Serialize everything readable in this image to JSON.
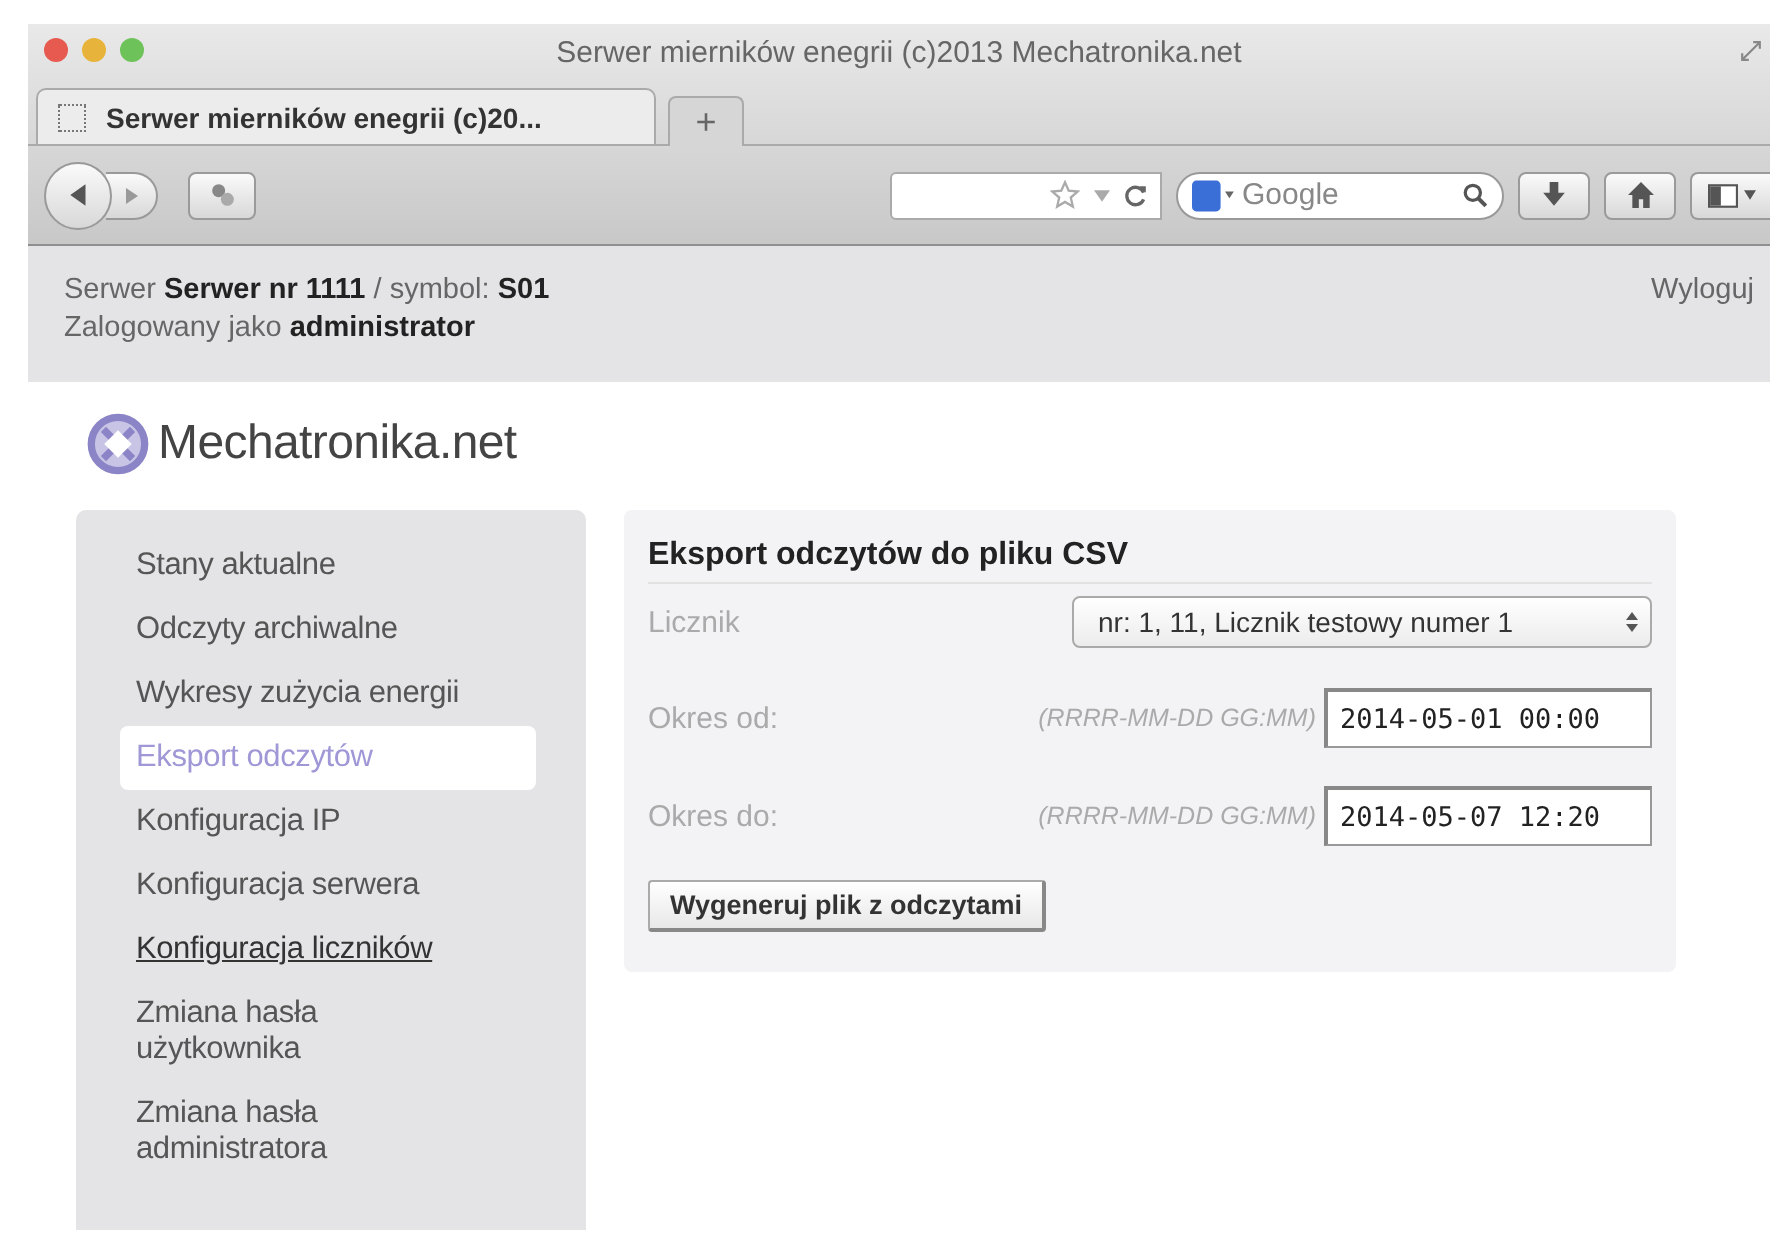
{
  "window": {
    "title": "Serwer mierników enegrii (c)2013 Mechatronika.net"
  },
  "browser": {
    "tabs": [
      {
        "label": "Serwer mierników enegrii (c)20...",
        "selected": true
      }
    ],
    "new_tab": "+",
    "search": {
      "placeholder": "Google"
    }
  },
  "header": {
    "server_line": "Serwer **Serwer nr 1111** / symbol: **S01**",
    "login_line": "Zalogowany jako **administrator**",
    "logout": "Wyloguj"
  },
  "logo": {
    "text": "Mechatronika.net"
  },
  "menu": {
    "items": [
      {
        "label": "Stany aktualne",
        "selected": false,
        "hovered": false
      },
      {
        "label": "Odczyty archiwalne",
        "selected": false,
        "hovered": false
      },
      {
        "label": "Wykresy zużycia energii",
        "selected": false,
        "hovered": false
      },
      {
        "label": "Eksport odczytów",
        "selected": true,
        "hovered": false
      },
      {
        "label": "Konfiguracja IP",
        "selected": false,
        "hovered": false
      },
      {
        "label": "Konfiguracja serwera",
        "selected": false,
        "hovered": false
      },
      {
        "label": "Konfiguracja liczników",
        "selected": false,
        "hovered": true
      },
      {
        "label": "Zmiana hasła użytkownika",
        "selected": false,
        "hovered": false
      },
      {
        "label": "Zmiana hasła administratora",
        "selected": false,
        "hovered": false
      }
    ]
  },
  "panel": {
    "title": "Eksport odczytów do pliku CSV",
    "fields": [
      {
        "kind": "select",
        "label": "Licznik",
        "value": "nr: 1, 11, Licznik testowy numer 1"
      },
      {
        "kind": "date",
        "label": "Okres od:",
        "hint": "(RRRR-MM-DD GG:MM)",
        "value": "2014-05-01 00:00"
      },
      {
        "kind": "date",
        "label": "Okres do:",
        "hint": "(RRRR-MM-DD GG:MM)",
        "value": "2014-05-07 12:20"
      }
    ],
    "button": "Wygeneruj plik z odczytami"
  }
}
